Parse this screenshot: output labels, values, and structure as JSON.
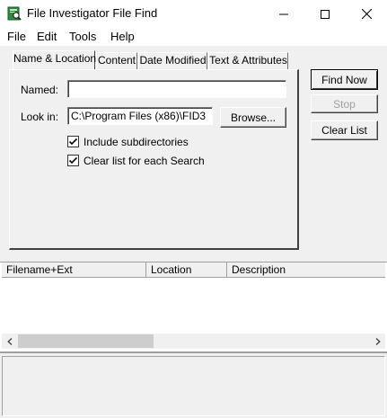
{
  "window": {
    "title": "File Investigator File Find"
  },
  "menu": {
    "items": [
      "File",
      "Edit",
      "Tools",
      "Help"
    ]
  },
  "tabs": [
    "Name & Location",
    "Content",
    "Date Modified",
    "Text & Attributes"
  ],
  "form": {
    "named_label": "Named:",
    "named_value": "",
    "lookin_label": "Look in:",
    "lookin_value": "C:\\Program Files (x86)\\FID3",
    "browse_label": "Browse...",
    "include_subdirs_label": "Include subdirectories",
    "include_subdirs_checked": true,
    "clear_list_label": "Clear list for each Search",
    "clear_list_checked": true
  },
  "actions": {
    "find_now": "Find Now",
    "stop": "Stop",
    "clear_list": "Clear List"
  },
  "results": {
    "columns": [
      "Filename+Ext",
      "Location",
      "Description"
    ],
    "rows": []
  },
  "colors": {
    "face": "#f0f0f0",
    "disabled_text": "#a0a0a0",
    "check": "#000000"
  }
}
